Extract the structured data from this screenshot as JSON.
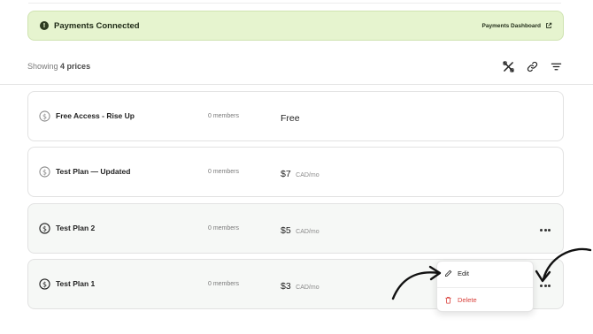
{
  "banner": {
    "title": "Payments Connected",
    "link_label": "Payments Dashboard",
    "info_icon": "info-icon",
    "link_icon": "external-link-icon",
    "background": "#e6f4cf"
  },
  "toolbar": {
    "showing_prefix": "Showing",
    "showing_count": "4 prices",
    "tools": [
      "crossed-tools-icon",
      "link-icon",
      "sort-icon"
    ]
  },
  "prices": [
    {
      "name": "Free Access - Rise Up",
      "members": "0 members",
      "amount": "Free",
      "unit": ""
    },
    {
      "name": "Test Plan — Updated",
      "members": "0 members",
      "amount": "$7",
      "unit": "CAD/mo"
    },
    {
      "name": "Test Plan 2",
      "members": "0 members",
      "amount": "$5",
      "unit": "CAD/mo"
    },
    {
      "name": "Test Plan 1",
      "members": "0 members",
      "amount": "$3",
      "unit": "CAD/mo"
    }
  ],
  "menu": {
    "edit_label": "Edit",
    "delete_label": "Delete",
    "delete_color": "#d9413b"
  }
}
